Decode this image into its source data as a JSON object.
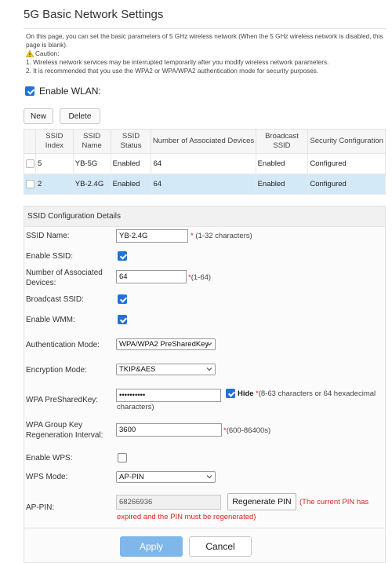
{
  "page": {
    "title": "5G Basic Network Settings",
    "description": "On this page, you can set the basic parameters of 5 GHz wireless network (When the 5 GHz wireless network is disabled, this page is blank).",
    "caution_label": "Caution:",
    "cautions": [
      "1. Wireless network services may be interrupted temporarily after you modify wireless network parameters.",
      "2. It is recommended that you use the WPA2 or WPA/WPA2 authentication mode for security purposes."
    ]
  },
  "enable_wlan": {
    "label": "Enable WLAN:",
    "checked": true
  },
  "toolbar": {
    "new_label": "New",
    "delete_label": "Delete"
  },
  "table": {
    "headers": [
      "SSID Index",
      "SSID Name",
      "SSID Status",
      "Number of Associated Devices",
      "Broadcast SSID",
      "Security Configuration"
    ],
    "rows": [
      {
        "index": "5",
        "name": "YB-5G",
        "status": "Enabled",
        "devices": "64",
        "broadcast": "Enabled",
        "security": "Configured"
      },
      {
        "index": "2",
        "name": "YB-2.4G",
        "status": "Enabled",
        "devices": "64",
        "broadcast": "Enabled",
        "security": "Configured"
      }
    ]
  },
  "details": {
    "header": "SSID Configuration Details",
    "ssid_name": {
      "label": "SSID Name:",
      "value": "YB-2.4G",
      "hint": "(1-32 characters)"
    },
    "enable_ssid": {
      "label": "Enable SSID:",
      "checked": true
    },
    "assoc_devices": {
      "label": "Number of Associated Devices:",
      "value": "64",
      "hint": "(1-64)"
    },
    "broadcast_ssid": {
      "label": "Broadcast SSID:",
      "checked": true
    },
    "enable_wmm": {
      "label": "Enable WMM:",
      "checked": true
    },
    "auth_mode": {
      "label": "Authentication Mode:",
      "value": "WPA/WPA2 PreSharedKey"
    },
    "encryption_mode": {
      "label": "Encryption Mode:",
      "value": "TKIP&AES"
    },
    "psk": {
      "label": "WPA PreSharedKey:",
      "value": "••••••••••",
      "hide_label": "Hide",
      "hint_line1": "(8-63 characters or 64 hexadecimal",
      "hint_line2": "characters)"
    },
    "group_key": {
      "label": "WPA Group Key Regeneration Interval:",
      "value": "3600",
      "hint": "(600-86400s)"
    },
    "enable_wps": {
      "label": "Enable WPS:",
      "checked": false
    },
    "wps_mode": {
      "label": "WPS Mode:",
      "value": "AP-PIN"
    },
    "ap_pin": {
      "label": "AP-PIN:",
      "value": "68266936",
      "regen_label": "Regenerate PIN",
      "note_line1": "(The current PIN has",
      "note_line2": "expired and the PIN must be regenerated)"
    }
  },
  "actions": {
    "apply_label": "Apply",
    "cancel_label": "Cancel"
  },
  "colors": {
    "accent": "#1e73d8",
    "selected_row": "#d4e9f8",
    "apply": "#7fb7ea",
    "required": "#dd2222"
  }
}
